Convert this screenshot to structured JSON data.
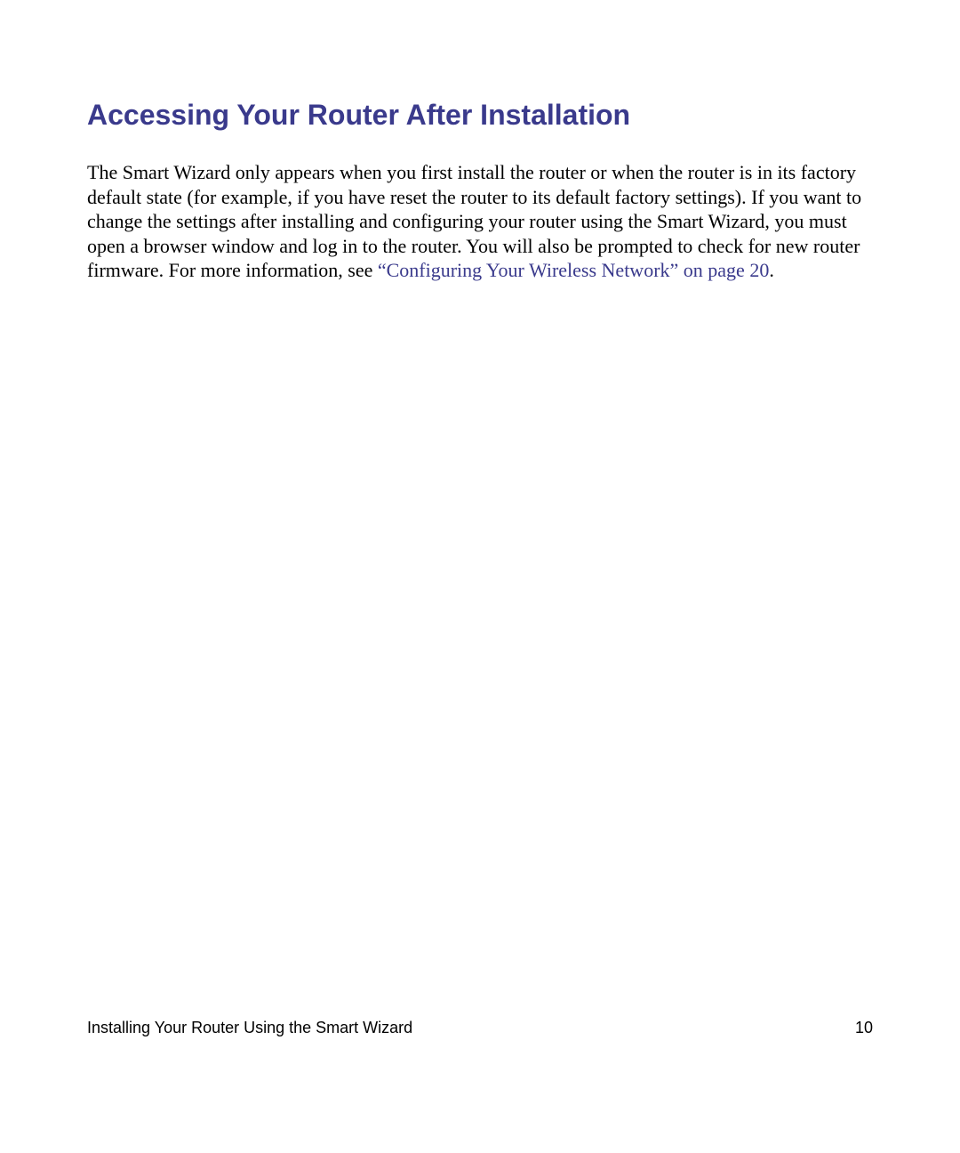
{
  "heading": "Accessing Your Router After Installation",
  "paragraph": {
    "text_before_link": "The Smart Wizard only appears when you first install the router or when the router is in its factory default state (for example, if you have reset the router to its default factory settings). If you want to change the settings after installing and configuring your router using the Smart Wizard, you must open a browser window and log in to the router. You will also be prompted to check for new router firmware. For more information, see ",
    "link_text": "“Configuring Your Wireless Network” on page 20",
    "text_after_link": "."
  },
  "footer": {
    "chapter": "Installing Your Router Using the Smart Wizard",
    "page_number": "10"
  }
}
